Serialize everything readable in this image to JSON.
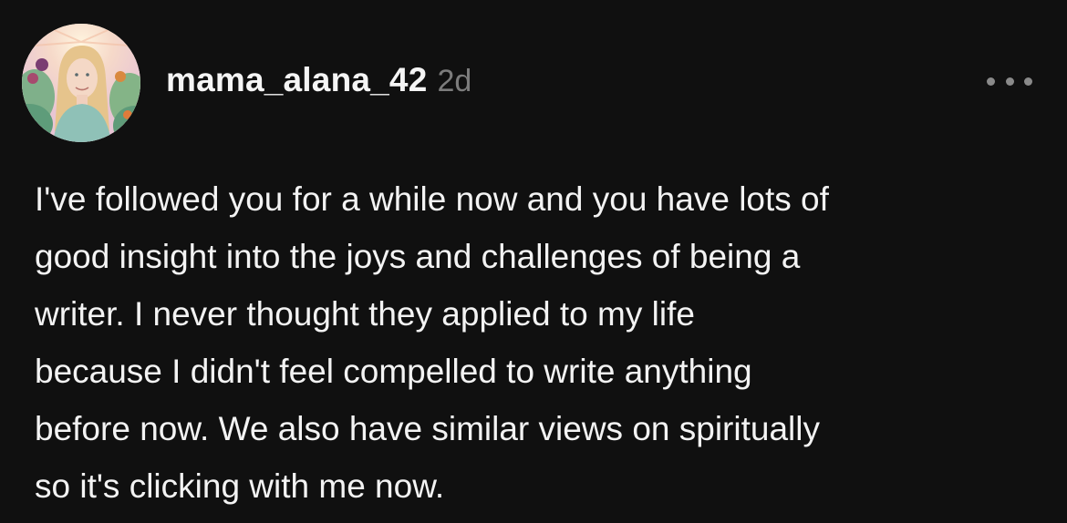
{
  "post": {
    "username": "mama_alana_42",
    "timestamp": "2d",
    "more_icon": "ellipsis-horizontal-icon",
    "avatar_icon": "user-avatar-illustration",
    "body_lines": [
      "I've followed you for a while now and you have lots of",
      "good insight into the joys and challenges of being a",
      "writer. I never thought they applied to my life",
      "because I didn't feel compelled to write anything",
      "before now. We also have similar views on spiritually",
      "so it's clicking with me now."
    ]
  },
  "colors": {
    "background": "#101010",
    "text_primary": "#f3f3f3",
    "text_secondary": "#7c7c7c"
  }
}
